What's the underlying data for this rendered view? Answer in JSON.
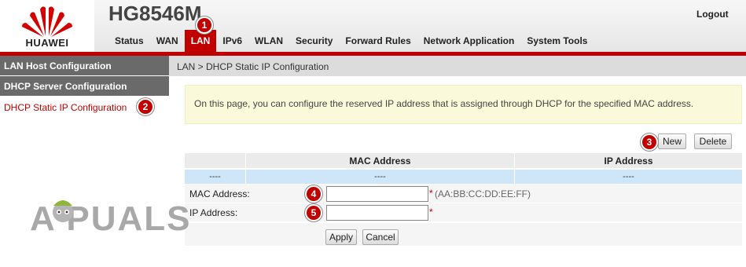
{
  "brand": {
    "logo_text": "HUAWEI",
    "device_name": "HG8546M",
    "logout_label": "Logout",
    "accent_color": "#c00000"
  },
  "nav": {
    "tabs": [
      {
        "label": "Status"
      },
      {
        "label": "WAN"
      },
      {
        "label": "LAN",
        "active": true
      },
      {
        "label": "IPv6"
      },
      {
        "label": "WLAN"
      },
      {
        "label": "Security"
      },
      {
        "label": "Forward Rules"
      },
      {
        "label": "Network Application"
      },
      {
        "label": "System Tools"
      }
    ]
  },
  "sidebar": {
    "items": [
      {
        "label": "LAN Host Configuration"
      },
      {
        "label": "DHCP Server Configuration"
      },
      {
        "label": "DHCP Static IP Configuration",
        "active": true
      }
    ]
  },
  "main": {
    "breadcrumb": "LAN > DHCP Static IP Configuration",
    "info": "On this page, you can configure the reserved IP address that is assigned through DHCP for the specified MAC address.",
    "new_label": "New",
    "delete_label": "Delete",
    "table": {
      "columns": [
        "",
        "MAC Address",
        "IP Address"
      ],
      "rows": [
        [
          "----",
          "----",
          "----"
        ]
      ]
    },
    "form": {
      "mac_label": "MAC Address:",
      "mac_value": "",
      "mac_hint": "(AA:BB:CC:DD:EE:FF)",
      "ip_label": "IP Address:",
      "ip_value": "",
      "required_mark": "*",
      "apply_label": "Apply",
      "cancel_label": "Cancel"
    }
  },
  "markers": [
    "1",
    "2",
    "3",
    "4",
    "5"
  ],
  "watermark": "A  PUALS"
}
